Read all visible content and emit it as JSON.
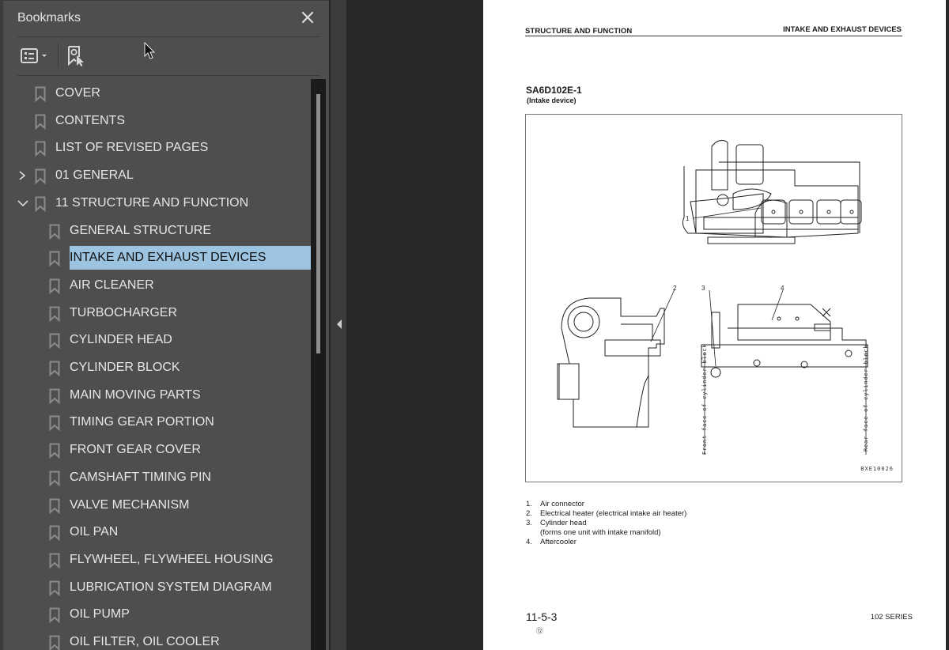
{
  "panel": {
    "title": "Bookmarks",
    "icons": {
      "close": "close-icon",
      "options": "list-options-icon",
      "options_dropdown": "chevron-down-icon",
      "find_current": "find-current-bookmark-icon"
    }
  },
  "bookmarks": [
    {
      "label": "COVER",
      "level": 0,
      "expander": "none"
    },
    {
      "label": "CONTENTS",
      "level": 0,
      "expander": "none"
    },
    {
      "label": "LIST OF REVISED PAGES",
      "level": 0,
      "expander": "none"
    },
    {
      "label": "01 GENERAL",
      "level": 0,
      "expander": "collapsed"
    },
    {
      "label": "11 STRUCTURE AND FUNCTION",
      "level": 0,
      "expander": "expanded"
    },
    {
      "label": "GENERAL STRUCTURE",
      "level": 1,
      "expander": "none"
    },
    {
      "label": "INTAKE AND EXHAUST DEVICES",
      "level": 1,
      "expander": "none",
      "selected": true
    },
    {
      "label": "AIR CLEANER",
      "level": 1,
      "expander": "none"
    },
    {
      "label": "TURBOCHARGER",
      "level": 1,
      "expander": "none"
    },
    {
      "label": "CYLINDER HEAD",
      "level": 1,
      "expander": "none"
    },
    {
      "label": "CYLINDER BLOCK",
      "level": 1,
      "expander": "none"
    },
    {
      "label": "MAIN MOVING PARTS",
      "level": 1,
      "expander": "none"
    },
    {
      "label": "TIMING GEAR PORTION",
      "level": 1,
      "expander": "none"
    },
    {
      "label": "FRONT GEAR COVER",
      "level": 1,
      "expander": "none"
    },
    {
      "label": "CAMSHAFT TIMING PIN",
      "level": 1,
      "expander": "none"
    },
    {
      "label": "VALVE MECHANISM",
      "level": 1,
      "expander": "none"
    },
    {
      "label": "OIL PAN",
      "level": 1,
      "expander": "none"
    },
    {
      "label": "FLYWHEEL, FLYWHEEL HOUSING",
      "level": 1,
      "expander": "none"
    },
    {
      "label": "LUBRICATION SYSTEM DIAGRAM",
      "level": 1,
      "expander": "none"
    },
    {
      "label": "OIL PUMP",
      "level": 1,
      "expander": "none"
    },
    {
      "label": "OIL FILTER, OIL COOLER",
      "level": 1,
      "expander": "none"
    }
  ],
  "colors": {
    "panel_bg": "#4e4e4e",
    "selection_bg": "#9cc3df",
    "viewer_bg": "#282828",
    "text": "#e6e6e6"
  },
  "page": {
    "header_left": "STRUCTURE AND FUNCTION",
    "header_right": "INTAKE AND EXHAUST DEVICES",
    "model": "SA6D102E-1",
    "model_sub": "(Intake device)",
    "figure": {
      "callouts": [
        "1",
        "2",
        "3",
        "4"
      ],
      "front_label": "Front face of cylinder block",
      "rear_label": "Rear face of cylinder block",
      "code": "BXE10026"
    },
    "legend": [
      {
        "num": "1.",
        "text": "Air connector"
      },
      {
        "num": "2.",
        "text": "Electrical heater (electrical intake air heater)"
      },
      {
        "num": "3.",
        "text": "Cylinder head"
      },
      {
        "num": "",
        "text": "(forms one unit with intake manifold)"
      },
      {
        "num": "4.",
        "text": "Aftercooler"
      }
    ],
    "page_number": "11-5-3",
    "revision_mark": "⑫",
    "series": "102 SERIES"
  }
}
